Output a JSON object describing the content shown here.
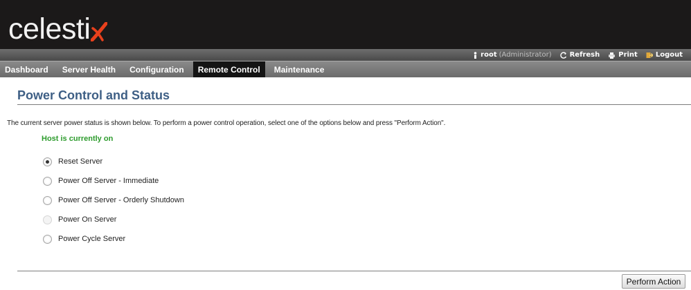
{
  "brand": {
    "logo_text": "celesti",
    "logo_mark": "x-swoosh-logo",
    "colors": {
      "mark": "#e8401c",
      "text": "#f2f2f2"
    }
  },
  "utility": {
    "user": "root",
    "role": "(Administrator)",
    "refresh_label": "Refresh",
    "print_label": "Print",
    "logout_label": "Logout"
  },
  "nav": {
    "tabs": [
      {
        "label": "Dashboard"
      },
      {
        "label": "Server Health"
      },
      {
        "label": "Configuration"
      },
      {
        "label": "Remote Control",
        "active": true
      },
      {
        "label": "Maintenance"
      }
    ]
  },
  "page": {
    "title": "Power Control and Status",
    "description": "The current server power status is shown below. To perform a power control operation, select one of the options below and press \"Perform Action\".",
    "status_text": "Host is currently on",
    "status_color": "#2c9b2c",
    "options": [
      {
        "label": "Reset Server",
        "checked": true,
        "disabled": false
      },
      {
        "label": "Power Off Server - Immediate",
        "checked": false,
        "disabled": false
      },
      {
        "label": "Power Off Server - Orderly Shutdown",
        "checked": false,
        "disabled": false
      },
      {
        "label": "Power On Server",
        "checked": false,
        "disabled": true
      },
      {
        "label": "Power Cycle Server",
        "checked": false,
        "disabled": false
      }
    ],
    "action_button": "Perform Action"
  }
}
